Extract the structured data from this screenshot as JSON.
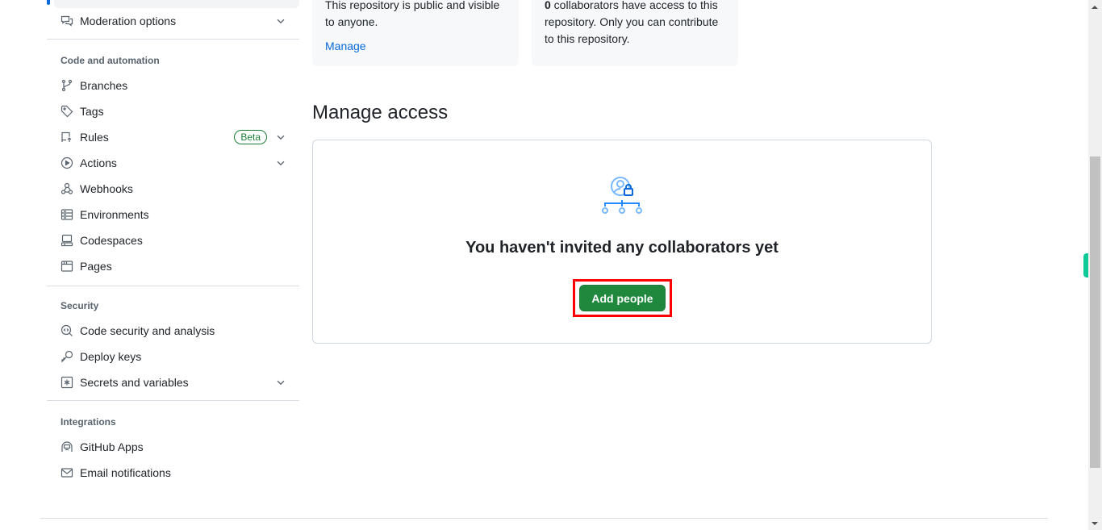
{
  "sidebar": {
    "top_item": {
      "label": "Moderation options",
      "icon": "comment-discussion-icon",
      "expandable": true
    },
    "sections": [
      {
        "title": "Code and automation",
        "items": [
          {
            "label": "Branches",
            "icon": "git-branch-icon"
          },
          {
            "label": "Tags",
            "icon": "tag-icon"
          },
          {
            "label": "Rules",
            "icon": "repo-push-icon",
            "badge": "Beta",
            "expandable": true
          },
          {
            "label": "Actions",
            "icon": "play-icon",
            "expandable": true
          },
          {
            "label": "Webhooks",
            "icon": "webhook-icon"
          },
          {
            "label": "Environments",
            "icon": "server-icon"
          },
          {
            "label": "Codespaces",
            "icon": "codespaces-icon"
          },
          {
            "label": "Pages",
            "icon": "browser-icon"
          }
        ]
      },
      {
        "title": "Security",
        "items": [
          {
            "label": "Code security and analysis",
            "icon": "codescan-icon"
          },
          {
            "label": "Deploy keys",
            "icon": "key-icon"
          },
          {
            "label": "Secrets and variables",
            "icon": "key-asterisk-icon",
            "expandable": true
          }
        ]
      },
      {
        "title": "Integrations",
        "items": [
          {
            "label": "GitHub Apps",
            "icon": "apps-icon"
          },
          {
            "label": "Email notifications",
            "icon": "mail-icon"
          }
        ]
      }
    ]
  },
  "cards": {
    "visibility": {
      "text": "This repository is public and visible to anyone.",
      "link": "Manage"
    },
    "collaborators": {
      "count": "0",
      "text": " collaborators have access to this repository. Only you can contribute to this repository."
    }
  },
  "manage_access": {
    "title": "Manage access",
    "empty_title": "You haven't invited any collaborators yet",
    "add_button": "Add people"
  },
  "colors": {
    "primary_button": "#1f883d",
    "link": "#0969da",
    "highlight": "#ff0000",
    "beta_badge": "#1a7f37"
  },
  "scrollbar": {
    "position_fraction": 0.3
  }
}
